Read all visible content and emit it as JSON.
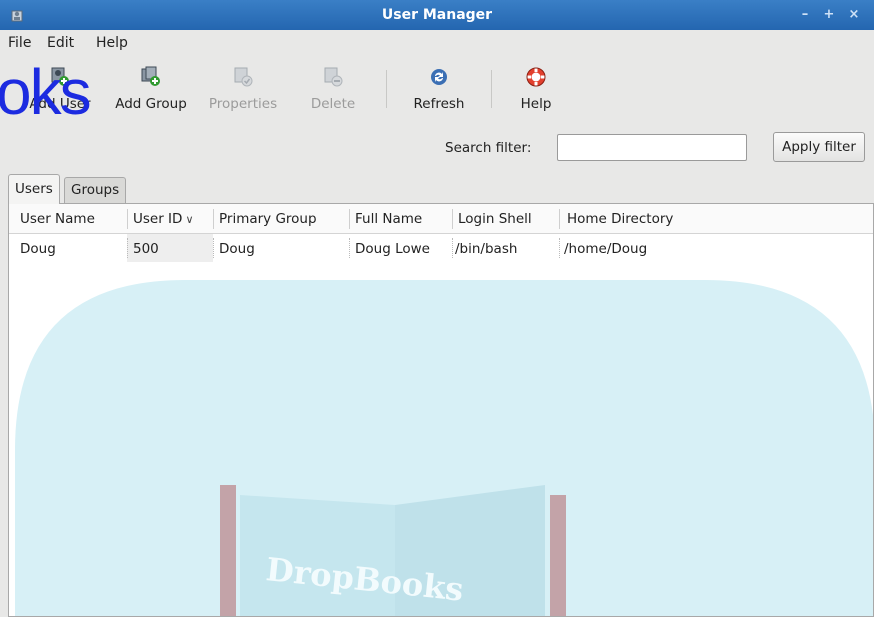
{
  "window": {
    "title": "User Manager"
  },
  "menubar": {
    "file": "File",
    "edit": "Edit",
    "help": "Help"
  },
  "toolbar": {
    "add_user": "Add User",
    "add_group": "Add Group",
    "properties": "Properties",
    "delete": "Delete",
    "refresh": "Refresh",
    "help": "Help"
  },
  "watermark": {
    "overlay_text": "oks",
    "logo_text": "DropBooks"
  },
  "search": {
    "label": "Search filter:",
    "value": "",
    "apply_label": "Apply filter"
  },
  "tabs": {
    "users": "Users",
    "groups": "Groups"
  },
  "table": {
    "columns": [
      "User Name",
      "User ID",
      "Primary Group",
      "Full Name",
      "Login Shell",
      "Home Directory"
    ],
    "rows": [
      [
        "Doug",
        "500",
        "Doug",
        "Doug Lowe",
        "/bin/bash",
        "/home/Doug"
      ]
    ]
  },
  "colors": {
    "titlebar": "#2466b0",
    "watermark_blue": "#1c2be0",
    "logo_cyan": "#d7f0f6"
  },
  "icons": {
    "app": "user-manager-app-icon",
    "add_user": "add-user-icon",
    "add_group": "add-group-icon",
    "properties": "properties-icon",
    "delete": "delete-icon",
    "refresh": "refresh-icon",
    "help": "lifebuoy-help-icon"
  }
}
